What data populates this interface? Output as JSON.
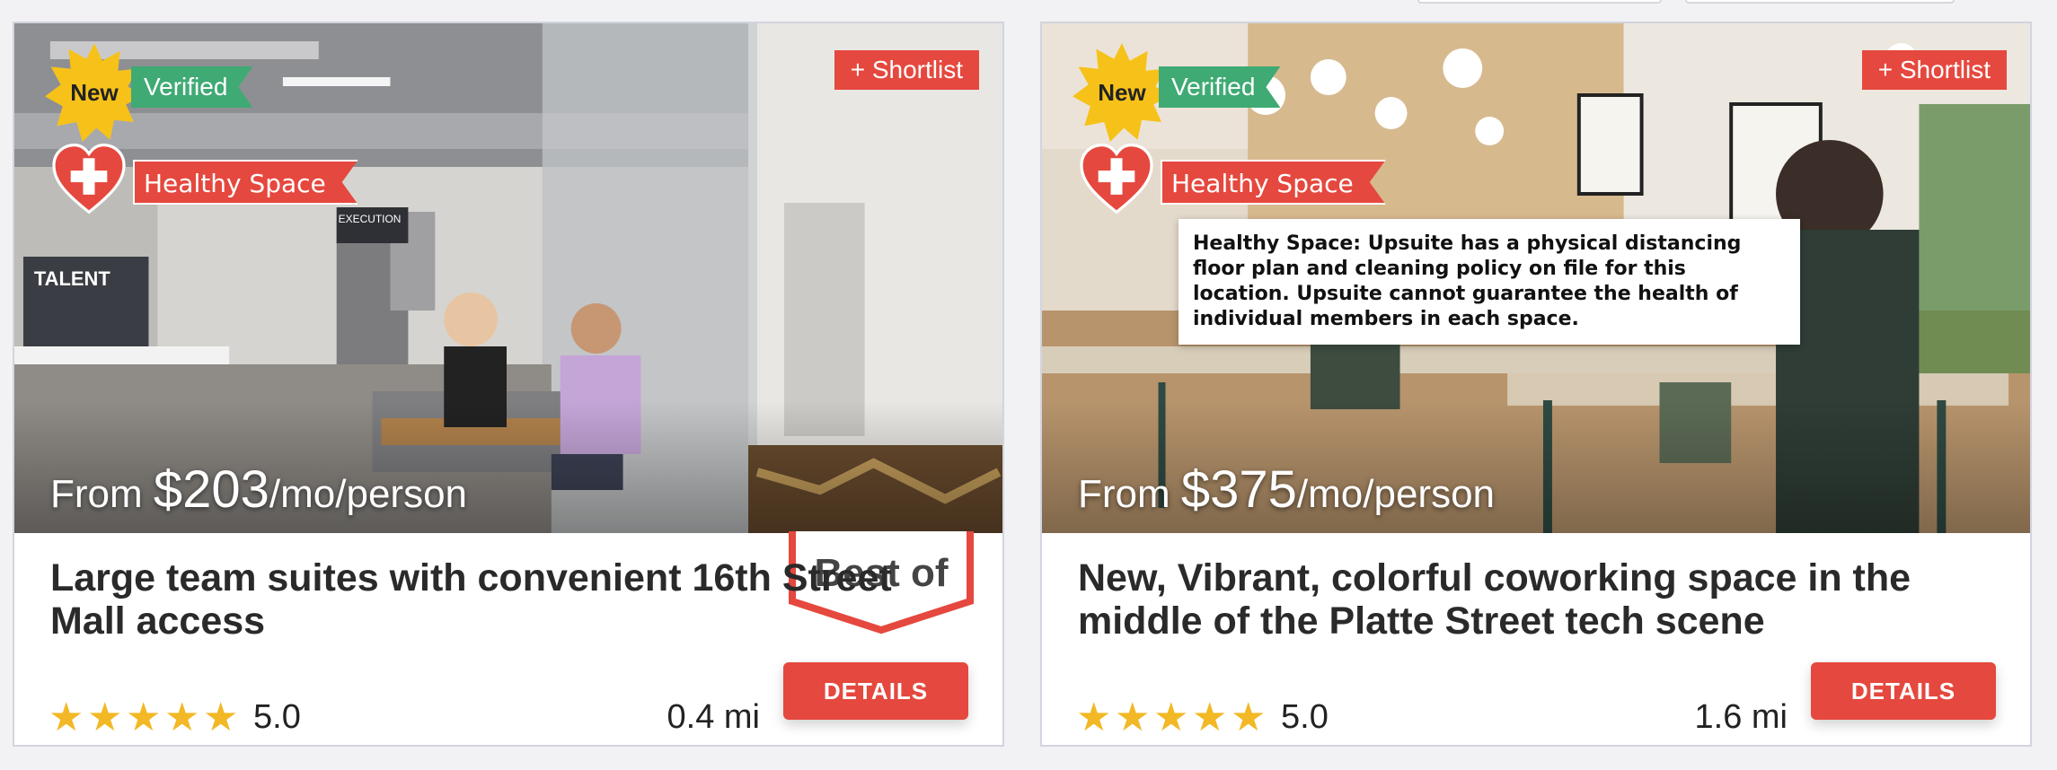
{
  "listings": [
    {
      "badges": {
        "new": "New",
        "verified": "Verified",
        "healthy": "Healthy Space"
      },
      "shortlist_label": "+ Shortlist",
      "price": {
        "prefix": "From ",
        "amount": "$203",
        "suffix": "/mo/person"
      },
      "title": "Large team suites with convenient 16th Street Mall access",
      "best_of": "Best of",
      "rating": "5.0",
      "distance": "0.4 mi",
      "details_label": "DETAILS",
      "photo_signs": {
        "sign1": "EXECUTION",
        "sign2": "TALENT"
      }
    },
    {
      "badges": {
        "new": "New",
        "verified": "Verified",
        "healthy": "Healthy Space"
      },
      "shortlist_label": "+ Shortlist",
      "price": {
        "prefix": "From ",
        "amount": "$375",
        "suffix": "/mo/person"
      },
      "title": "New, Vibrant, colorful coworking space in the middle of the Platte Street tech scene",
      "tooltip": "Healthy Space: Upsuite has a physical distancing floor plan and cleaning policy on file for this location.  Upsuite cannot guarantee the health of individual members in each space.",
      "rating": "5.0",
      "distance": "1.6 mi",
      "details_label": "DETAILS"
    }
  ],
  "icons": {
    "star": "★",
    "cross": "heart-plus-icon"
  },
  "colors": {
    "accent_red": "#e5483e",
    "verified_green": "#3faa74",
    "star_gold": "#f2b825",
    "burst_yellow": "#f6c21a"
  }
}
